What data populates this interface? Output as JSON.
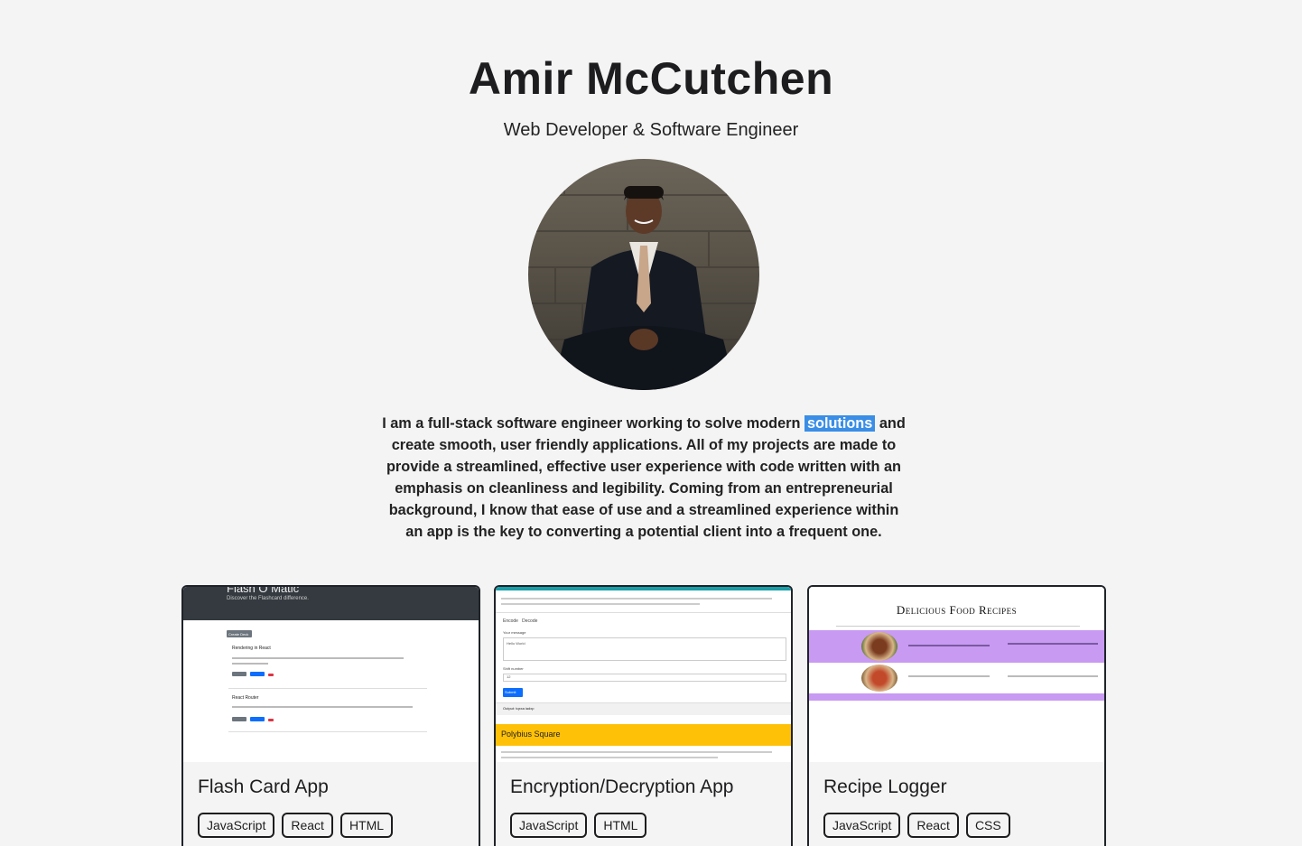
{
  "header": {
    "name": "Amir McCutchen",
    "subtitle": "Web Developer & Software Engineer"
  },
  "bio": {
    "before": "I am a full-stack software engineer working to solve modern ",
    "highlight": "solutions",
    "after": " and create smooth, user friendly applications. All of my projects are made to provide a streamlined, effective user experience with code written with an emphasis on cleanliness and legibility. Coming from an entrepreneurial background, I know that ease of use and a streamlined experience within an app is the key to converting a potential client into a frequent one."
  },
  "projects": [
    {
      "title": "Flash Card App",
      "tags": [
        "JavaScript",
        "React",
        "HTML"
      ],
      "thumb": {
        "heading": "Flash O Matic",
        "subheading": "Discover the Flashcard difference.",
        "button": "Create Deck",
        "deck1": "Rendering in React",
        "deck2": "React Router"
      }
    },
    {
      "title": "Encryption/Decryption App",
      "tags": [
        "JavaScript",
        "HTML"
      ],
      "thumb": {
        "encode": "Encode",
        "decode": "Decode",
        "message_label": "Your message",
        "message_value": "Hello World",
        "shift_label": "Shift number",
        "shift_value": "12",
        "submit": "Submit",
        "output": "Output: tqxxa iadxp",
        "section": "Polybius Square"
      }
    },
    {
      "title": "Recipe Logger",
      "tags": [
        "JavaScript",
        "React",
        "CSS"
      ],
      "thumb": {
        "heading": "Delicious Food Recipes"
      }
    }
  ],
  "colors": {
    "background": "#f4f4f4",
    "highlight": "#3a8ee6",
    "card_border": "#1f2329",
    "recipe_purple": "#c89af2",
    "polybius_yellow": "#ffc107"
  }
}
